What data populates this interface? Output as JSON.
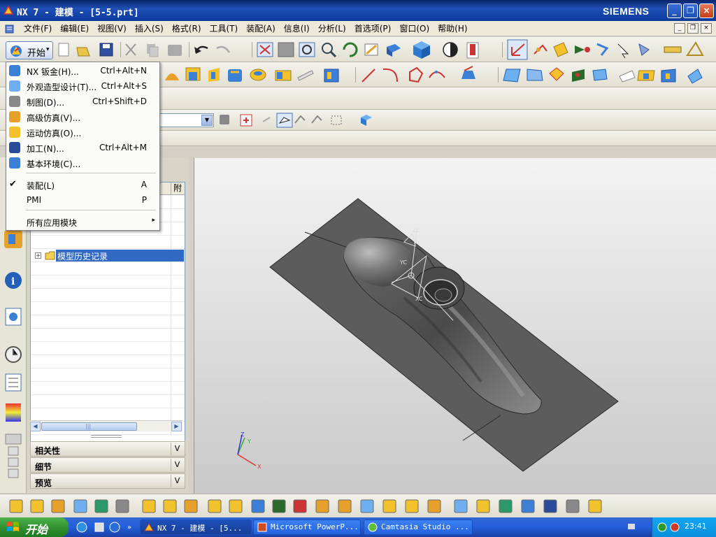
{
  "window": {
    "title": "NX 7 - 建模 - [5-5.prt]",
    "brand": "SIEMENS",
    "minimize": "_",
    "maximize": "❐",
    "close": "×"
  },
  "menubar": {
    "items": [
      "文件(F)",
      "编辑(E)",
      "视图(V)",
      "插入(S)",
      "格式(R)",
      "工具(T)",
      "装配(A)",
      "信息(I)",
      "分析(L)",
      "首选项(P)",
      "窗口(O)",
      "帮助(H)"
    ],
    "mdi_min": "_",
    "mdi_restore": "❐",
    "mdi_close": "×"
  },
  "start_button": {
    "label": "开始",
    "arrow": "▾"
  },
  "start_menu": {
    "items": [
      {
        "label": "NX 钣金(H)...",
        "shortcut": "Ctrl+Alt+N"
      },
      {
        "label": "外观造型设计(T)...",
        "shortcut": "Ctrl+Alt+S"
      },
      {
        "label": "制图(D)...",
        "shortcut": "Ctrl+Shift+D"
      },
      {
        "label": "高级仿真(V)...",
        "shortcut": ""
      },
      {
        "label": "运动仿真(O)...",
        "shortcut": ""
      },
      {
        "label": "加工(N)...",
        "shortcut": "Ctrl+Alt+M"
      },
      {
        "label": "基本环境(C)...",
        "shortcut": ""
      }
    ],
    "assembly": {
      "label": "装配(L)",
      "shortcut": "A",
      "check": "✔"
    },
    "pmi": {
      "label": "PMI",
      "shortcut": "P"
    },
    "all_apps": {
      "label": "所有应用模块",
      "arrow": "▸"
    }
  },
  "navigator": {
    "column2": "附",
    "history_label": "模型历史记录",
    "plus": "+",
    "accordions": [
      "相关性",
      "细节",
      "预览"
    ],
    "chevron": "V",
    "scroll_left": "◀",
    "scroll_right": "▶",
    "scroll_grip": "|||"
  },
  "viewport": {
    "axis_labels": {
      "x": "X",
      "y": "Y",
      "z": "Z"
    },
    "csys_labels": {
      "zc": "ZC",
      "yc": "YC",
      "xc": "XC"
    }
  },
  "taskbar": {
    "start_label": "开始",
    "tasks": [
      "NX 7 - 建模 - [5...",
      "Microsoft PowerP...",
      "Camtasia Studio ..."
    ],
    "clock": "23:41"
  },
  "colors": {
    "title_blue": "#0a246a",
    "selection": "#316ac5",
    "model_gray": "#5e5e5e",
    "taskbar_blue": "#245edb",
    "start_green": "#2f8f2f"
  }
}
